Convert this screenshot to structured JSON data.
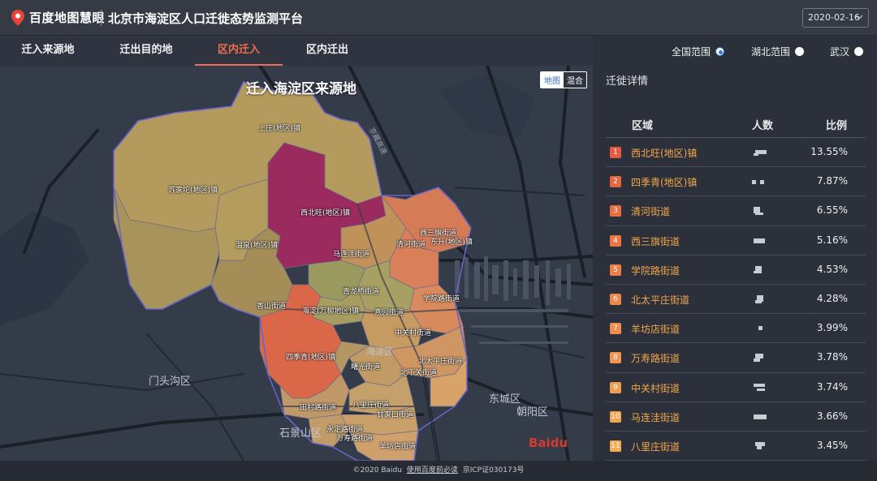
{
  "header": {
    "logo_text": "百度地图慧眼",
    "title": "北京市海淀区人口迁徙态势监测平台",
    "date_value": "2020-02-16"
  },
  "tabs": [
    {
      "label": "迁入来源地"
    },
    {
      "label": "迁出目的地"
    },
    {
      "label": "区内迁入"
    },
    {
      "label": "区内迁出"
    }
  ],
  "active_tab": "区内迁入",
  "map": {
    "title": "迁入海淀区来源地",
    "toggle_map": "地图",
    "toggle_hybrid": "混合",
    "towns": [
      "上庄(地区)镇",
      "苏家坨(地区)镇",
      "西北旺(地区)镇",
      "温泉(地区)镇",
      "西三旗街道",
      "东升(地区)镇",
      "清河街道",
      "马连洼街道",
      "青龙桥街道",
      "香山街道",
      "海淀(万柳地区)镇",
      "燕园街道",
      "学院路街道",
      "中关村街道",
      "四季青(地区)镇",
      "曙光街道",
      "北太平庄街道",
      "北下关街道",
      "田村路街道",
      "八里庄街道",
      "甘家口街道",
      "永定路街道",
      "万寿路街道",
      "羊坊店街道"
    ],
    "districts": [
      "门头沟区",
      "石景山区",
      "东城区",
      "朝阳区",
      "海淀区"
    ],
    "road_label": "京藏高速"
  },
  "scope": {
    "options": [
      "全国范围",
      "湖北范围",
      "武汉"
    ],
    "selected": "全国范围"
  },
  "detail": {
    "title": "迁徙详情",
    "columns": [
      "区域",
      "人数",
      "比例"
    ],
    "rows": [
      {
        "rank": "1",
        "name": "西北旺(地区)镇",
        "pct": "13.55%",
        "color": "#e8593f"
      },
      {
        "rank": "2",
        "name": "四季青(地区)镇",
        "pct": "7.87%",
        "color": "#e8643f"
      },
      {
        "rank": "3",
        "name": "清河街道",
        "pct": "6.55%",
        "color": "#eb6d42"
      },
      {
        "rank": "4",
        "name": "西三旗街道",
        "pct": "5.16%",
        "color": "#ec7544"
      },
      {
        "rank": "5",
        "name": "学院路街道",
        "pct": "4.53%",
        "color": "#ee7d46"
      },
      {
        "rank": "6",
        "name": "北太平庄街道",
        "pct": "4.28%",
        "color": "#ef8548"
      },
      {
        "rank": "7",
        "name": "羊坊店街道",
        "pct": "3.99%",
        "color": "#f08d4a"
      },
      {
        "rank": "8",
        "name": "万寿路街道",
        "pct": "3.78%",
        "color": "#f1954c"
      },
      {
        "rank": "9",
        "name": "中关村街道",
        "pct": "3.74%",
        "color": "#f29d4e"
      },
      {
        "rank": "10",
        "name": "马连洼街道",
        "pct": "3.66%",
        "color": "#f3a550"
      },
      {
        "rank": "11",
        "name": "八里庄街道",
        "pct": "3.45%",
        "color": "#f4ad52"
      }
    ]
  },
  "footer": {
    "copyright": "©2020 Baidu",
    "link": "使用百度前必读",
    "icp": "京ICP证030173号"
  },
  "baidu_mark": "Baidu"
}
